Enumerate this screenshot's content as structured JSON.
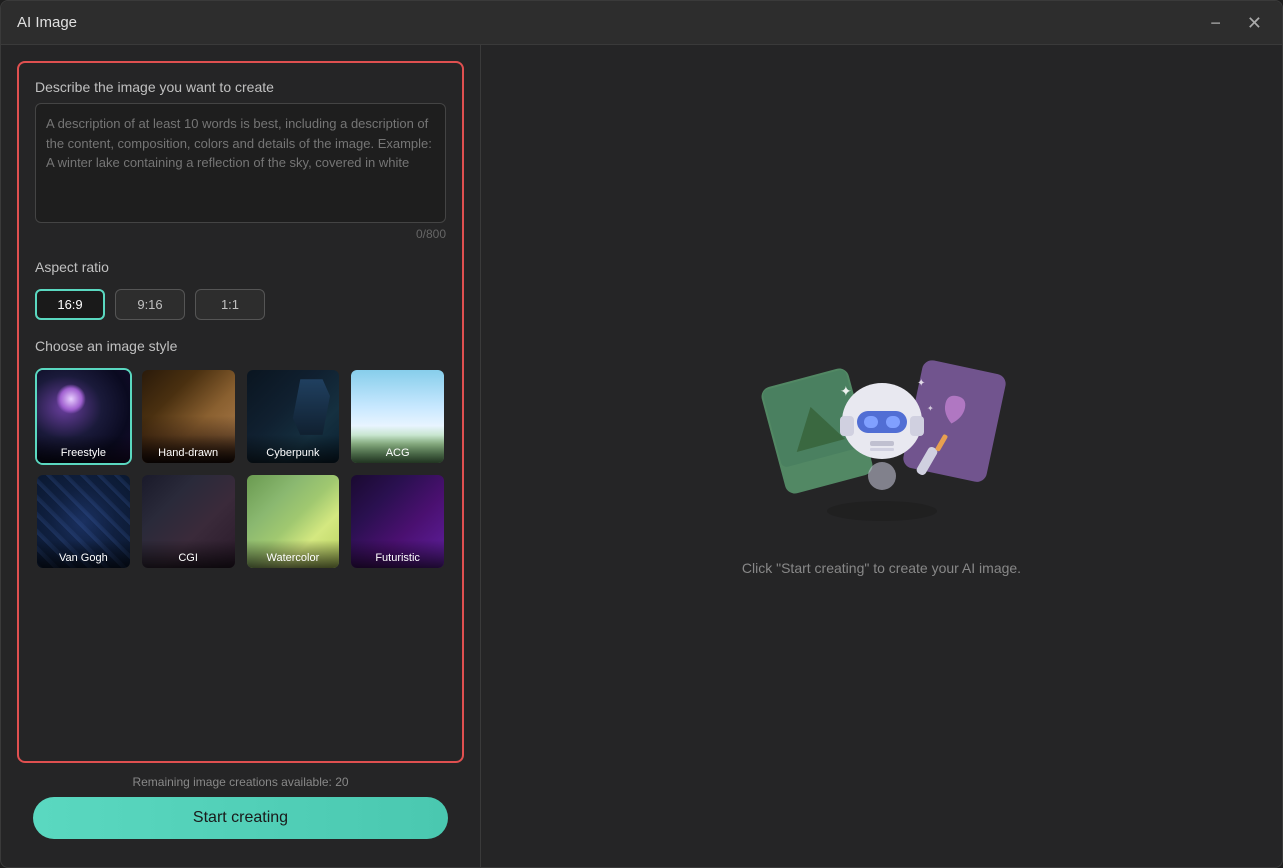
{
  "window": {
    "title": "AI Image",
    "minimize_label": "minimize",
    "close_label": "close"
  },
  "left": {
    "describe_label": "Describe the image you want to create",
    "textarea_placeholder": "A description of at least 10 words is best, including a description of the content, composition, colors and details of the image. Example: A winter lake containing a reflection of the sky, covered in white",
    "char_count": "0/800",
    "aspect_label": "Aspect ratio",
    "aspects": [
      {
        "label": "16:9",
        "active": true
      },
      {
        "label": "9:16",
        "active": false
      },
      {
        "label": "1:1",
        "active": false
      }
    ],
    "style_label": "Choose an image style",
    "styles": [
      {
        "label": "Freestyle",
        "active": true,
        "thumb": "freestyle"
      },
      {
        "label": "Hand-drawn",
        "active": false,
        "thumb": "handdrawn"
      },
      {
        "label": "Cyberpunk",
        "active": false,
        "thumb": "cyberpunk"
      },
      {
        "label": "ACG",
        "active": false,
        "thumb": "acg"
      },
      {
        "label": "Van Gogh",
        "active": false,
        "thumb": "vangogh"
      },
      {
        "label": "CGI",
        "active": false,
        "thumb": "cgi"
      },
      {
        "label": "Watercolor",
        "active": false,
        "thumb": "watercolor"
      },
      {
        "label": "Futuristic",
        "active": false,
        "thumb": "futuristic"
      }
    ],
    "remaining": "Remaining image creations available: 20",
    "start_btn": "Start creating"
  },
  "right": {
    "hint": "Click \"Start creating\" to create your AI image."
  }
}
